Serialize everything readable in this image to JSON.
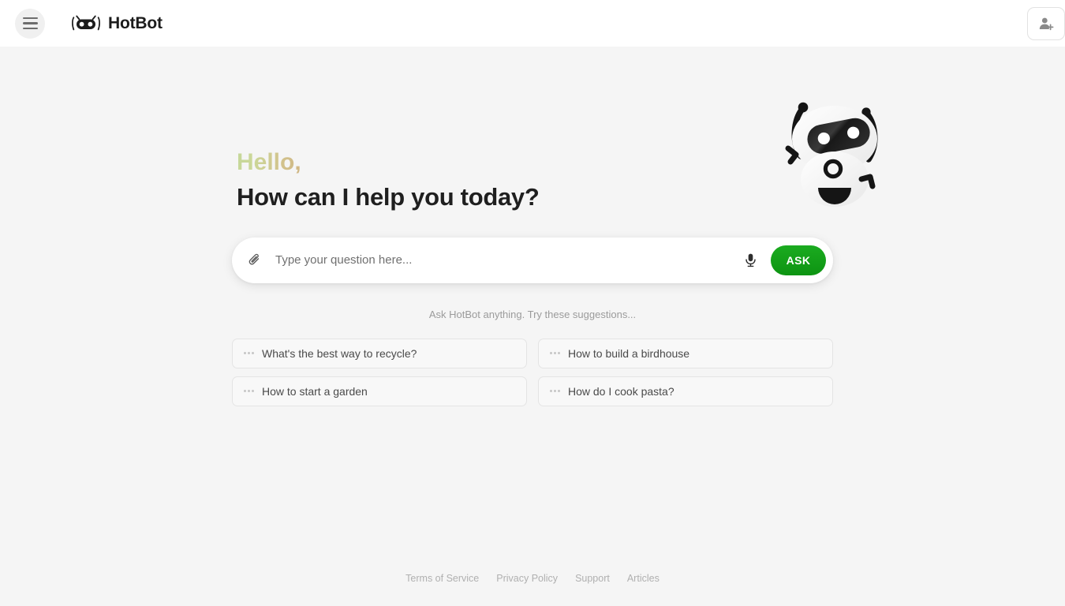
{
  "header": {
    "menu_icon": "hamburger-menu-icon",
    "logo_icon": "hotbot-robot-logo-icon",
    "brand_name": "HotBot",
    "account_icon": "person-add-icon"
  },
  "hero": {
    "greeting": "Hello,",
    "headline": "How can I help you today?",
    "mascot_icon": "robot-mascot-illustration",
    "greeting_gradient_from": "#c2d79a",
    "greeting_gradient_to": "#cfb583"
  },
  "search": {
    "attach_icon": "paperclip-icon",
    "placeholder": "Type your question here...",
    "value": "",
    "mic_icon": "microphone-icon",
    "ask_label": "ASK",
    "ask_color": "#0d9412"
  },
  "suggestions": {
    "caption": "Ask HotBot anything. Try these suggestions...",
    "items": [
      {
        "label": "What's the best way to recycle?",
        "icon": "dots-icon"
      },
      {
        "label": "How to build a birdhouse",
        "icon": "dots-icon"
      },
      {
        "label": "How to start a garden",
        "icon": "dots-icon"
      },
      {
        "label": "How do I cook pasta?",
        "icon": "dots-icon"
      }
    ]
  },
  "footer": {
    "links": [
      {
        "label": "Terms of Service"
      },
      {
        "label": "Privacy Policy"
      },
      {
        "label": "Support"
      },
      {
        "label": "Articles"
      }
    ]
  }
}
